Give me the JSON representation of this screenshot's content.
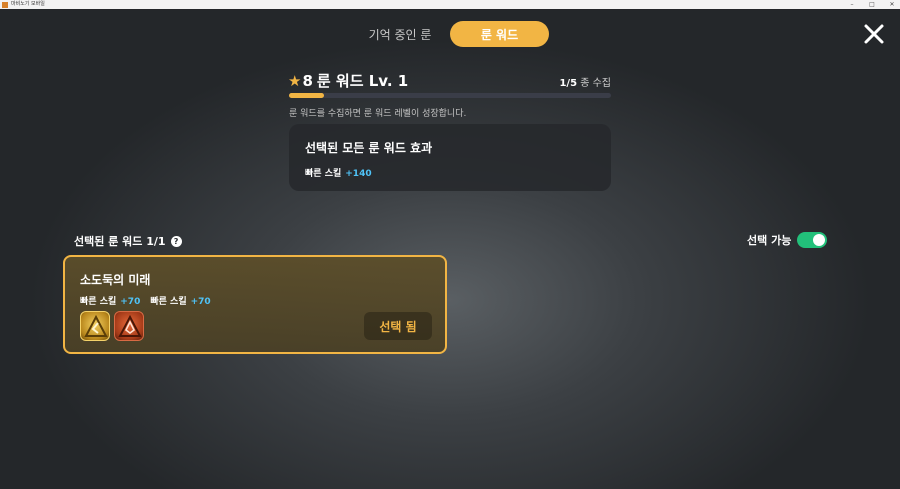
{
  "window": {
    "title": "마비노기 모바일",
    "controls": {
      "minimize": "–",
      "maximize": "□",
      "close": "✕"
    }
  },
  "tabs": [
    {
      "label": "기억 중인 룬",
      "active": false
    },
    {
      "label": "룬 워드",
      "active": true
    }
  ],
  "rune_level": {
    "star_icon": "★",
    "stars": "8",
    "title": "룬 워드 Lv. 1",
    "collected": "1/5",
    "collected_suffix": " 종 수집",
    "progress_fraction": 0.11,
    "hint": "룬 워드를 수집하면 룬 워드 레벨이 성장합니다."
  },
  "effects": {
    "title": "선택된 모든 룬 워드 효과",
    "stat_name": "빠른 스킬",
    "stat_value": "+140"
  },
  "selected": {
    "header": "선택된 룬 워드 1/1",
    "help_icon": "?",
    "selectable_label": "선택 가능",
    "selectable_on": true
  },
  "rune_card": {
    "name": "소도둑의 미래",
    "stats": [
      {
        "name": "빠른 스킬",
        "value": "+70"
      },
      {
        "name": "빠른 스킬",
        "value": "+70"
      }
    ],
    "button_label": "선택 됨"
  },
  "colors": {
    "accent": "#f2b544",
    "stat_value": "#4fc3f7",
    "toggle_on": "#22c07a"
  }
}
